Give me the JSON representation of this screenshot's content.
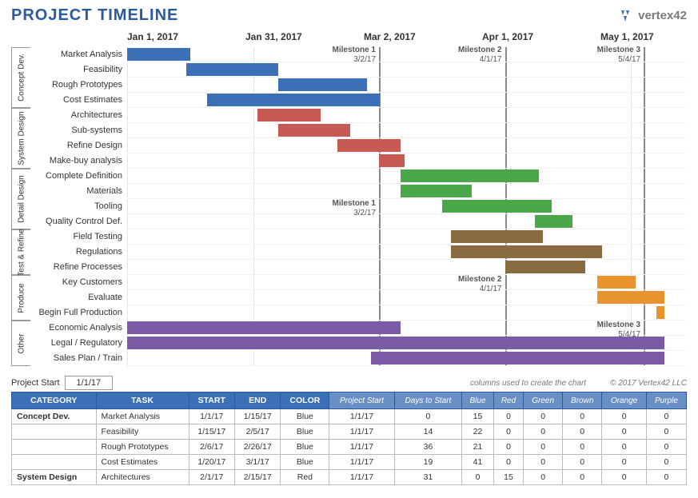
{
  "title": "PROJECT TIMELINE",
  "logo": "vertex42",
  "axis": [
    "Jan 1, 2017",
    "Jan 31, 2017",
    "Mar 2, 2017",
    "Apr 1, 2017",
    "May 1, 2017"
  ],
  "milestones": [
    {
      "name": "Milestone 1",
      "date": "3/2/17",
      "pct": 45
    },
    {
      "name": "Milestone 2",
      "date": "4/1/17",
      "pct": 67.5
    },
    {
      "name": "Milestone 3",
      "date": "5/4/17",
      "pct": 92.3
    }
  ],
  "milestone_repeats": [
    {
      "name": "Milestone 1",
      "date": "3/2/17",
      "pct": 45,
      "row": 10
    },
    {
      "name": "Milestone 2",
      "date": "4/1/17",
      "pct": 67.5,
      "row": 15
    },
    {
      "name": "Milestone 3",
      "date": "5/4/17",
      "pct": 92.3,
      "row": 18
    }
  ],
  "groups": [
    {
      "name": "Concept Dev.",
      "tasks": [
        {
          "name": "Market Analysis",
          "start": 0,
          "dur": 11.3,
          "color": "blue"
        },
        {
          "name": "Feasibility",
          "start": 10.5,
          "dur": 16.5,
          "color": "blue"
        },
        {
          "name": "Rough Prototypes",
          "start": 27,
          "dur": 15.8,
          "color": "blue"
        },
        {
          "name": "Cost Estimates",
          "start": 14.3,
          "dur": 30.8,
          "color": "blue"
        }
      ]
    },
    {
      "name": "System Design",
      "tasks": [
        {
          "name": "Architectures",
          "start": 23.3,
          "dur": 11.3,
          "color": "red"
        },
        {
          "name": "Sub-systems",
          "start": 27,
          "dur": 12.8,
          "color": "red"
        },
        {
          "name": "Refine Design",
          "start": 37.5,
          "dur": 11.3,
          "color": "red"
        },
        {
          "name": "Make-buy analysis",
          "start": 45,
          "dur": 4.5,
          "color": "red"
        }
      ]
    },
    {
      "name": "Detail Design",
      "tasks": [
        {
          "name": "Complete Definition",
          "start": 48.8,
          "dur": 24.8,
          "color": "green"
        },
        {
          "name": "Materials",
          "start": 48.8,
          "dur": 12.8,
          "color": "green"
        },
        {
          "name": "Tooling",
          "start": 56.3,
          "dur": 19.5,
          "color": "green"
        },
        {
          "name": "Quality Control Def.",
          "start": 72.8,
          "dur": 6.8,
          "color": "green"
        }
      ]
    },
    {
      "name": "Test & Refine",
      "tasks": [
        {
          "name": "Field Testing",
          "start": 57.8,
          "dur": 16.5,
          "color": "brown"
        },
        {
          "name": "Regulations",
          "start": 57.8,
          "dur": 27,
          "color": "brown"
        },
        {
          "name": "Refine Processes",
          "start": 67.5,
          "dur": 14.3,
          "color": "brown"
        }
      ]
    },
    {
      "name": "Produce",
      "tasks": [
        {
          "name": "Key Customers",
          "start": 84,
          "dur": 6.8,
          "color": "orange"
        },
        {
          "name": "Evaluate",
          "start": 84,
          "dur": 12,
          "color": "orange"
        },
        {
          "name": "Begin Full Production",
          "start": 94.5,
          "dur": 1.5,
          "color": "orange"
        }
      ]
    },
    {
      "name": "Other",
      "tasks": [
        {
          "name": "Economic Analysis",
          "start": 0,
          "dur": 48.8,
          "color": "purple"
        },
        {
          "name": "Legal / Regulatory",
          "start": 0,
          "dur": 96,
          "color": "purple"
        },
        {
          "name": "Sales Plan / Train",
          "start": 43.5,
          "dur": 52.5,
          "color": "purple"
        }
      ]
    }
  ],
  "project_start_label": "Project Start",
  "project_start": "1/1/17",
  "note": "columns used to create the chart",
  "copyright": "© 2017 Vertex42 LLC",
  "table": {
    "headers": [
      "CATEGORY",
      "TASK",
      "START",
      "END",
      "COLOR"
    ],
    "sub_headers": [
      "Project Start",
      "Days to Start",
      "Blue",
      "Red",
      "Green",
      "Brown",
      "Orange",
      "Purple"
    ],
    "rows": [
      {
        "cat": "Concept Dev.",
        "task": "Market Analysis",
        "start": "1/1/17",
        "end": "1/15/17",
        "color": "Blue",
        "ps": "1/1/17",
        "dts": "0",
        "v": [
          "15",
          "0",
          "0",
          "0",
          "0",
          "0"
        ]
      },
      {
        "cat": "",
        "task": "Feasibility",
        "start": "1/15/17",
        "end": "2/5/17",
        "color": "Blue",
        "ps": "1/1/17",
        "dts": "14",
        "v": [
          "22",
          "0",
          "0",
          "0",
          "0",
          "0"
        ]
      },
      {
        "cat": "",
        "task": "Rough Prototypes",
        "start": "2/6/17",
        "end": "2/26/17",
        "color": "Blue",
        "ps": "1/1/17",
        "dts": "36",
        "v": [
          "21",
          "0",
          "0",
          "0",
          "0",
          "0"
        ]
      },
      {
        "cat": "",
        "task": "Cost Estimates",
        "start": "1/20/17",
        "end": "3/1/17",
        "color": "Blue",
        "ps": "1/1/17",
        "dts": "19",
        "v": [
          "41",
          "0",
          "0",
          "0",
          "0",
          "0"
        ]
      },
      {
        "cat": "System Design",
        "task": "Architectures",
        "start": "2/1/17",
        "end": "2/15/17",
        "color": "Red",
        "ps": "1/1/17",
        "dts": "31",
        "v": [
          "0",
          "15",
          "0",
          "0",
          "0",
          "0"
        ]
      }
    ]
  },
  "chart_data": {
    "type": "gantt",
    "title": "PROJECT TIMELINE",
    "date_range": [
      "2017-01-01",
      "2017-05-10"
    ],
    "axis_ticks": [
      "2017-01-01",
      "2017-01-31",
      "2017-03-02",
      "2017-04-01",
      "2017-05-01"
    ],
    "milestones": [
      {
        "name": "Milestone 1",
        "date": "2017-03-02"
      },
      {
        "name": "Milestone 2",
        "date": "2017-04-01"
      },
      {
        "name": "Milestone 3",
        "date": "2017-05-04"
      }
    ],
    "series": [
      {
        "group": "Concept Dev.",
        "task": "Market Analysis",
        "start": "2017-01-01",
        "end": "2017-01-15",
        "color": "blue"
      },
      {
        "group": "Concept Dev.",
        "task": "Feasibility",
        "start": "2017-01-15",
        "end": "2017-02-05",
        "color": "blue"
      },
      {
        "group": "Concept Dev.",
        "task": "Rough Prototypes",
        "start": "2017-02-06",
        "end": "2017-02-26",
        "color": "blue"
      },
      {
        "group": "Concept Dev.",
        "task": "Cost Estimates",
        "start": "2017-01-20",
        "end": "2017-03-01",
        "color": "blue"
      },
      {
        "group": "System Design",
        "task": "Architectures",
        "start": "2017-02-01",
        "end": "2017-02-15",
        "color": "red"
      },
      {
        "group": "System Design",
        "task": "Sub-systems",
        "start": "2017-02-06",
        "end": "2017-02-22",
        "color": "red"
      },
      {
        "group": "System Design",
        "task": "Refine Design",
        "start": "2017-02-20",
        "end": "2017-03-06",
        "color": "red"
      },
      {
        "group": "System Design",
        "task": "Make-buy analysis",
        "start": "2017-03-02",
        "end": "2017-03-08",
        "color": "red"
      },
      {
        "group": "Detail Design",
        "task": "Complete Definition",
        "start": "2017-03-07",
        "end": "2017-04-09",
        "color": "green"
      },
      {
        "group": "Detail Design",
        "task": "Materials",
        "start": "2017-03-07",
        "end": "2017-03-24",
        "color": "green"
      },
      {
        "group": "Detail Design",
        "task": "Tooling",
        "start": "2017-03-17",
        "end": "2017-04-12",
        "color": "green"
      },
      {
        "group": "Detail Design",
        "task": "Quality Control Def.",
        "start": "2017-04-08",
        "end": "2017-04-17",
        "color": "green"
      },
      {
        "group": "Test & Refine",
        "task": "Field Testing",
        "start": "2017-03-19",
        "end": "2017-04-10",
        "color": "brown"
      },
      {
        "group": "Test & Refine",
        "task": "Regulations",
        "start": "2017-03-19",
        "end": "2017-04-24",
        "color": "brown"
      },
      {
        "group": "Test & Refine",
        "task": "Refine Processes",
        "start": "2017-04-01",
        "end": "2017-04-20",
        "color": "brown"
      },
      {
        "group": "Produce",
        "task": "Key Customers",
        "start": "2017-04-23",
        "end": "2017-05-02",
        "color": "orange"
      },
      {
        "group": "Produce",
        "task": "Evaluate",
        "start": "2017-04-23",
        "end": "2017-05-09",
        "color": "orange"
      },
      {
        "group": "Produce",
        "task": "Begin Full Production",
        "start": "2017-05-07",
        "end": "2017-05-09",
        "color": "orange"
      },
      {
        "group": "Other",
        "task": "Economic Analysis",
        "start": "2017-01-01",
        "end": "2017-03-07",
        "color": "purple"
      },
      {
        "group": "Other",
        "task": "Legal / Regulatory",
        "start": "2017-01-01",
        "end": "2017-05-09",
        "color": "purple"
      },
      {
        "group": "Other",
        "task": "Sales Plan / Train",
        "start": "2017-02-28",
        "end": "2017-05-09",
        "color": "purple"
      }
    ]
  }
}
